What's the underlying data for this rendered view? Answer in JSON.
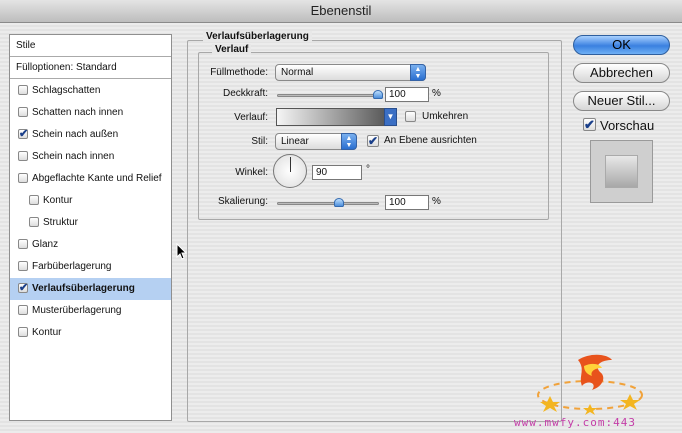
{
  "window": {
    "title": "Ebenenstil"
  },
  "sidebar": {
    "header": "Stile",
    "blend_options": "Fülloptionen: Standard",
    "items": [
      {
        "label": "Schlagschatten",
        "checked": false
      },
      {
        "label": "Schatten nach innen",
        "checked": false
      },
      {
        "label": "Schein nach außen",
        "checked": true
      },
      {
        "label": "Schein nach innen",
        "checked": false
      },
      {
        "label": "Abgeflachte Kante und Relief",
        "checked": false
      },
      {
        "label": "Kontur",
        "checked": false
      },
      {
        "label": "Struktur",
        "checked": false
      },
      {
        "label": "Glanz",
        "checked": false
      },
      {
        "label": "Farbüberlagerung",
        "checked": false
      },
      {
        "label": "Verlaufsüberlagerung",
        "checked": true
      },
      {
        "label": "Musterüberlagerung",
        "checked": false
      },
      {
        "label": "Kontur",
        "checked": false
      }
    ]
  },
  "panel": {
    "outer_title": "Verlaufsüberlagerung",
    "inner_title": "Verlauf",
    "blend_mode_label": "Füllmethode:",
    "blend_mode_value": "Normal",
    "opacity_label": "Deckkraft:",
    "opacity_value": "100",
    "opacity_unit": "%",
    "gradient_label": "Verlauf:",
    "reverse_label": "Umkehren",
    "style_label": "Stil:",
    "style_value": "Linear",
    "align_label": "An Ebene ausrichten",
    "angle_label": "Winkel:",
    "angle_value": "90",
    "angle_unit": "°",
    "scale_label": "Skalierung:",
    "scale_value": "100",
    "scale_unit": "%",
    "check_mark": "✔",
    "arrow_up": "▲",
    "arrow_down": "▼"
  },
  "buttons": {
    "ok": "OK",
    "cancel": "Abbrechen",
    "new_style": "Neuer Stil...",
    "preview_label": "Vorschau"
  },
  "watermark": {
    "text": "www.mwfy.com:443"
  },
  "colors": {
    "selection": "#b5d0f2",
    "accent_blue": "#3a80e0"
  }
}
